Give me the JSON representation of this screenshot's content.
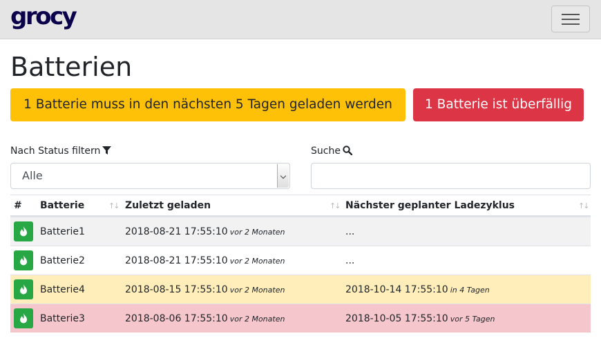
{
  "navbar": {
    "brand": "grocy"
  },
  "page_title": "Batterien",
  "alerts": {
    "warning": "1 Batterie muss in den nächsten 5 Tagen geladen werden",
    "danger": "1 Batterie ist überfällig"
  },
  "filters": {
    "status_label": "Nach Status filtern",
    "status_value": "Alle",
    "search_label": "Suche",
    "search_value": ""
  },
  "table": {
    "headers": [
      "#",
      "Batterie",
      "Zuletzt geladen",
      "Nächster geplanter Ladezyklus"
    ],
    "rows": [
      {
        "name": "Batterie1",
        "last": "2018-08-21 17:55:10",
        "last_rel": "vor 2 Monaten",
        "next": "...",
        "next_rel": ""
      },
      {
        "name": "Batterie2",
        "last": "2018-08-21 17:55:10",
        "last_rel": "vor 2 Monaten",
        "next": "...",
        "next_rel": ""
      },
      {
        "name": "Batterie4",
        "last": "2018-08-15 17:55:10",
        "last_rel": "vor 2 Monaten",
        "next": "2018-10-14 17:55:10",
        "next_rel": "in 4 Tagen"
      },
      {
        "name": "Batterie3",
        "last": "2018-08-06 17:55:10",
        "last_rel": "vor 2 Monaten",
        "next": "2018-10-05 17:55:10",
        "next_rel": "vor 5 Tagen"
      }
    ]
  },
  "colors": {
    "warning": "#ffc107",
    "danger": "#dc3545",
    "success": "#28a745",
    "brand": "#0b024c"
  }
}
